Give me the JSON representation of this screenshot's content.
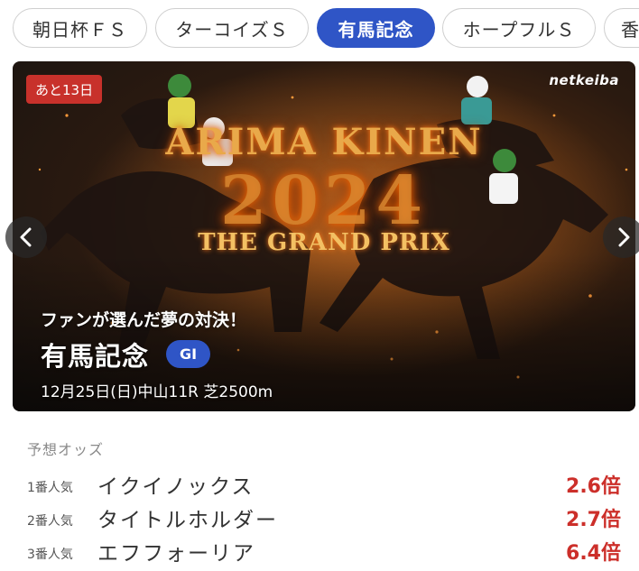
{
  "tabs": [
    {
      "label": "朝日杯ＦＳ",
      "active": false
    },
    {
      "label": "ターコイズＳ",
      "active": false
    },
    {
      "label": "有馬記念",
      "active": true
    },
    {
      "label": "ホープフルＳ",
      "active": false
    },
    {
      "label": "香",
      "active": false
    }
  ],
  "banner": {
    "days_badge": "あと13日",
    "brand": "netkeiba",
    "title_en": "ARIMA KINEN",
    "title_year": "2024",
    "title_sub": "THE GRAND PRIX",
    "catch": "ファンが選んだ夢の対決！",
    "race_name": "有馬記念",
    "grade": "GI",
    "race_info": "12月25日(日)中山11R 芝2500m"
  },
  "odds": {
    "heading": "予想オッズ",
    "rows": [
      {
        "rank": "1番人気",
        "horse": "イクイノックス",
        "odds": "2.6倍"
      },
      {
        "rank": "2番人気",
        "horse": "タイトルホルダー",
        "odds": "2.7倍"
      },
      {
        "rank": "3番人気",
        "horse": "エフフォーリア",
        "odds": "6.4倍"
      }
    ]
  },
  "colors": {
    "accent": "#2f55c6",
    "odds_red": "#cc2f2a",
    "badge_red": "#c8312b"
  }
}
